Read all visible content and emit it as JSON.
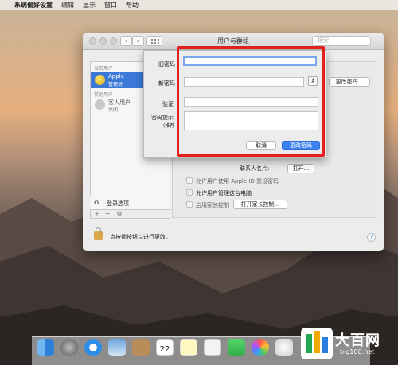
{
  "menubar": {
    "apple": "",
    "app_name": "系统偏好设置",
    "items": [
      "编辑",
      "显示",
      "窗口",
      "帮助"
    ]
  },
  "window": {
    "title": "用户与群组",
    "search_placeholder": "搜索",
    "nav_back": "‹",
    "nav_forward": "›"
  },
  "sidebar": {
    "current_users_header": "当前用户",
    "selected_user": {
      "name": "Apple",
      "role": "管理员"
    },
    "other_users_header": "其他用户",
    "guest_user": {
      "name": "客人用户",
      "status": "关闭"
    },
    "login_options": "登录选项",
    "tools": [
      "+",
      "−",
      "⚙"
    ]
  },
  "content": {
    "change_password_button": "更改密码...",
    "contacts_card_label": "联系人名片:",
    "open_button": "打开...",
    "allow_apple_id_reset": "允许用户使用 Apple ID 重设密码",
    "allow_admin": "允许用户管理这台电脑",
    "parental_controls": "启用家长控制",
    "open_parental_controls_button": "打开家长控制...",
    "lock_text": "点按锁按钮以进行更改。",
    "help": "?"
  },
  "sheet": {
    "old_password_label": "旧密码",
    "new_password_label": "新密码",
    "verify_label": "验证",
    "hint_label": "密码提示",
    "hint_sub": "(推荐",
    "key_icon": "⚷",
    "cancel": "取消",
    "change": "更改密码"
  },
  "dock": {
    "calendar_day": "22"
  },
  "watermark": {
    "title": "大百网",
    "url": "big100.net"
  },
  "colors": {
    "highlight": "#e3201b",
    "accent": "#3c79d7"
  }
}
